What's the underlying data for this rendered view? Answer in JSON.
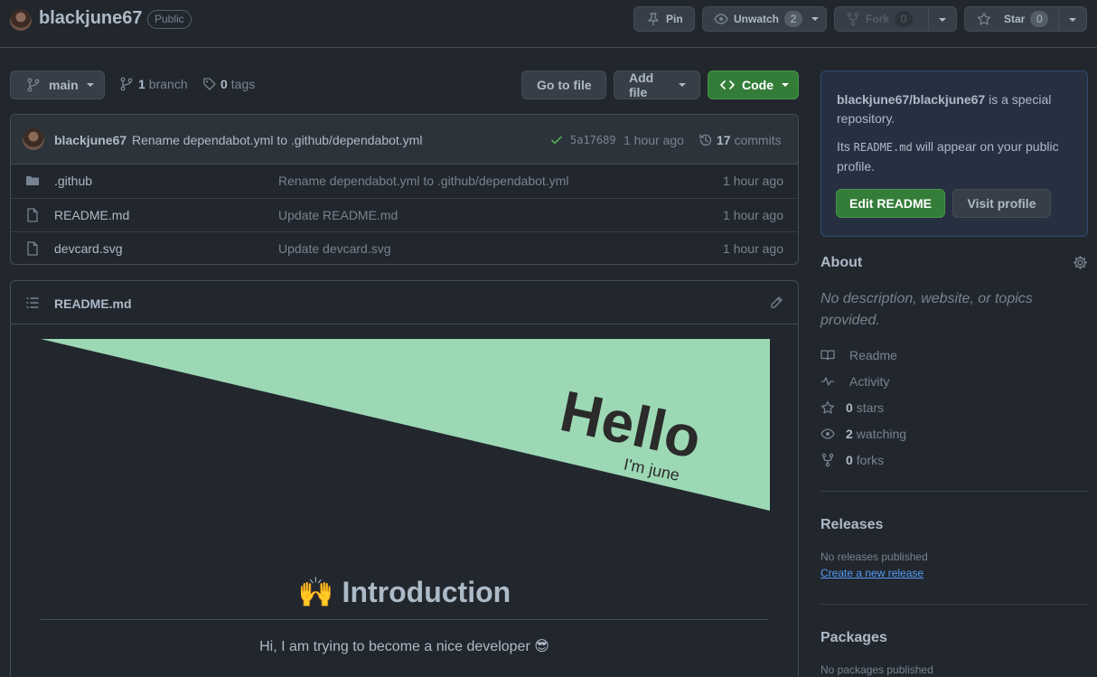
{
  "header": {
    "owner": "blackjune67",
    "visibility": "Public",
    "pin_label": "Pin",
    "watch_label": "Unwatch",
    "watch_count": "2",
    "fork_label": "Fork",
    "fork_count": "0",
    "star_label": "Star",
    "star_count": "0"
  },
  "nav": {
    "branch": "main",
    "branch_count": "1",
    "branch_word": "branch",
    "tag_count": "0",
    "tag_word": "tags",
    "go_to_file": "Go to file",
    "add_file": "Add file",
    "code": "Code"
  },
  "commit": {
    "author": "blackjune67",
    "message": "Rename dependabot.yml to .github/dependabot.yml",
    "sha": "5a17689",
    "time": "1 hour ago",
    "commit_count": "17",
    "commit_word": "commits"
  },
  "files": [
    {
      "name": ".github",
      "type": "folder",
      "message": "Rename dependabot.yml to .github/dependabot.yml",
      "age": "1 hour ago"
    },
    {
      "name": "README.md",
      "type": "file",
      "message": "Update README.md",
      "age": "1 hour ago"
    },
    {
      "name": "devcard.svg",
      "type": "file",
      "message": "Update devcard.svg",
      "age": "1 hour ago"
    }
  ],
  "readme": {
    "filename": "README.md",
    "banner_title": "Hello",
    "banner_subtitle": "I'm june",
    "heading_emoji": "🙌",
    "heading": "Introduction",
    "intro": "Hi, I am trying to become a nice developer 😎"
  },
  "special": {
    "repo_path": "blackjune67/blackjune67",
    "line1_suffix": " is a special repository.",
    "line2_prefix": "Its ",
    "line2_code": "README.md",
    "line2_suffix": " will appear on your public profile.",
    "edit_label": "Edit README",
    "visit_label": "Visit profile"
  },
  "about": {
    "title": "About",
    "description": "No description, website, or topics provided.",
    "items": [
      {
        "icon": "book-icon",
        "count": "",
        "label": "Readme"
      },
      {
        "icon": "pulse-icon",
        "count": "",
        "label": "Activity"
      },
      {
        "icon": "star-icon",
        "count": "0",
        "label": "stars"
      },
      {
        "icon": "eye-icon",
        "count": "2",
        "label": "watching"
      },
      {
        "icon": "repo-forked-icon",
        "count": "0",
        "label": "forks"
      }
    ]
  },
  "releases": {
    "title": "Releases",
    "empty": "No releases published",
    "create_link": "Create a new release"
  },
  "packages": {
    "title": "Packages",
    "empty": "No packages published"
  },
  "colors": {
    "background": "#22272e",
    "banner": "#9cd8b4",
    "primary_button": "#347d39",
    "link": "#539bf5"
  }
}
